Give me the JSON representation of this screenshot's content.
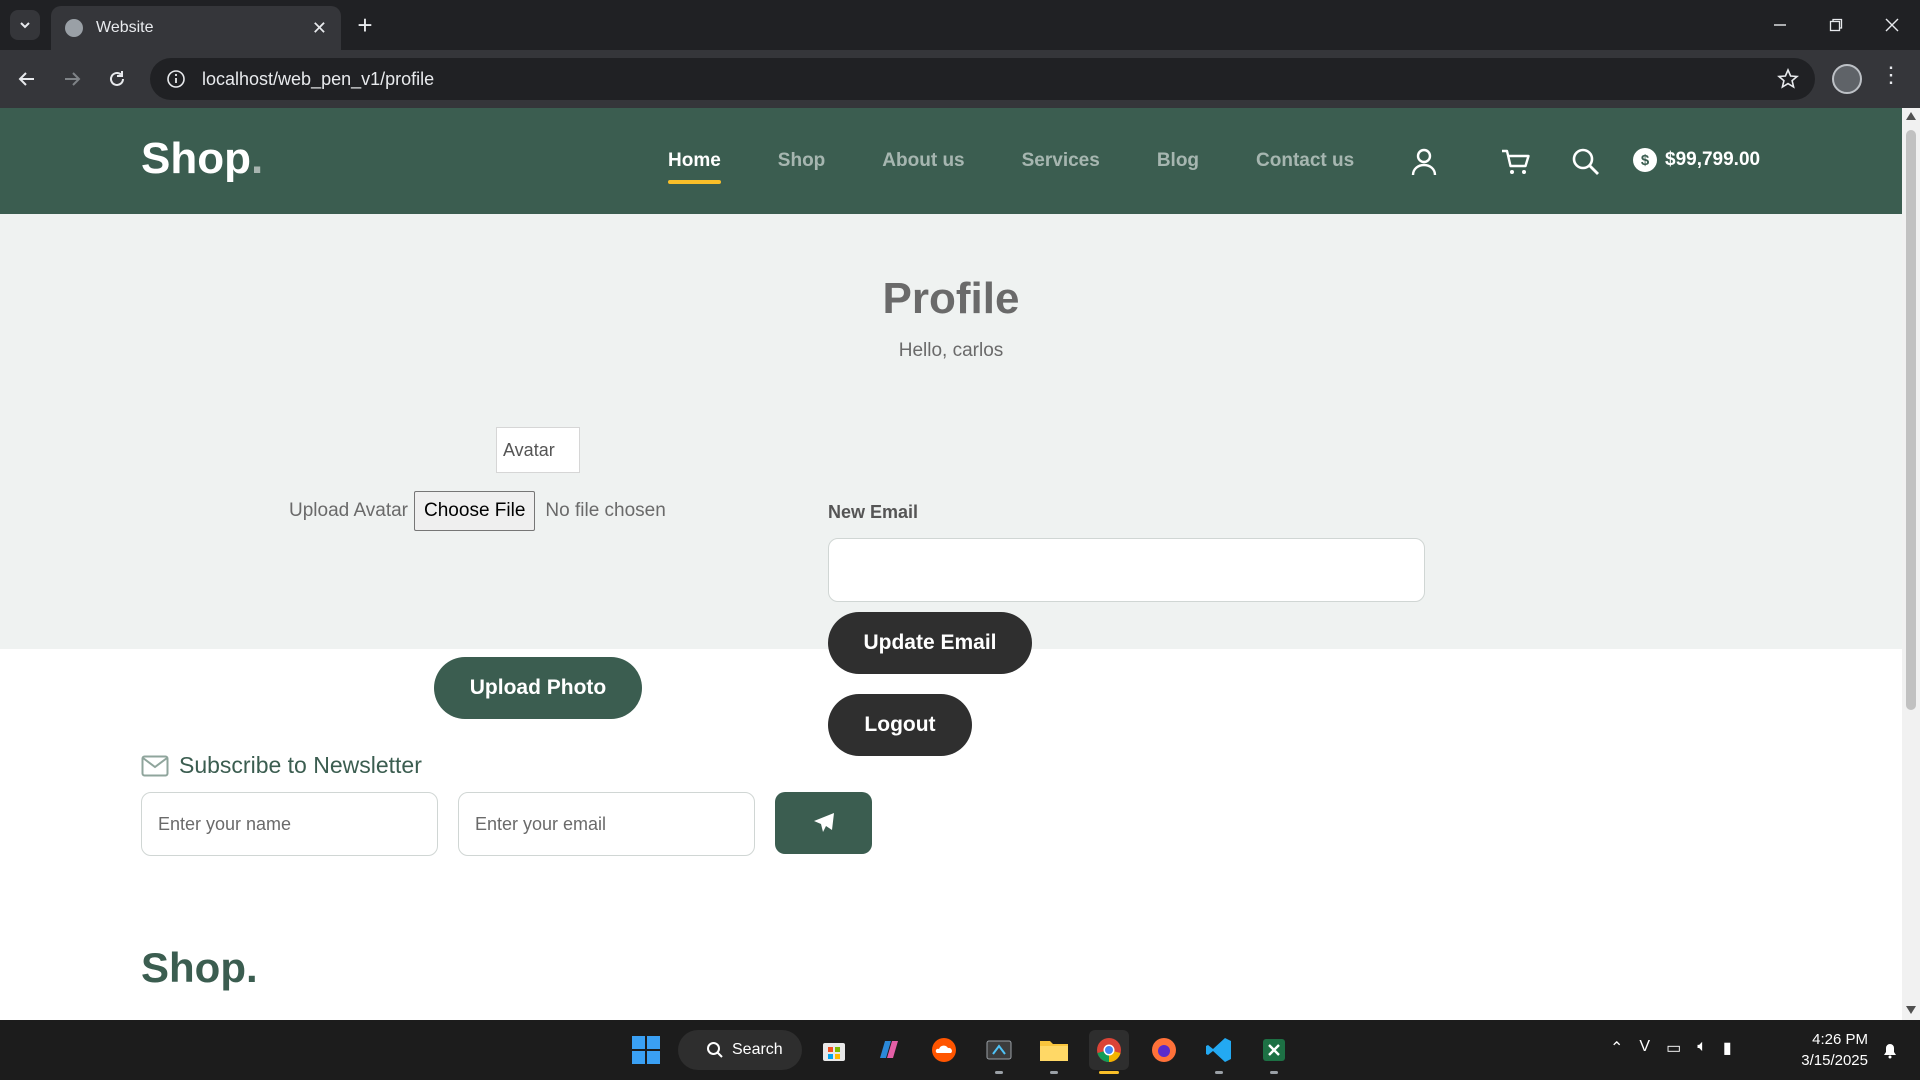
{
  "browser": {
    "tab_title": "Website",
    "url": "localhost/web_pen_v1/profile"
  },
  "site": {
    "logo": "Shop",
    "logo_dot": ".",
    "nav": [
      {
        "label": "Home",
        "active": true
      },
      {
        "label": "Shop",
        "active": false
      },
      {
        "label": "About us",
        "active": false
      },
      {
        "label": "Services",
        "active": false
      },
      {
        "label": "Blog",
        "active": false
      },
      {
        "label": "Contact us",
        "active": false
      }
    ],
    "balance": "$99,799.00",
    "coin_symbol": "$",
    "icons": [
      "user-icon",
      "cart-icon",
      "search-icon"
    ],
    "brand_color": "#3b5d50",
    "accent_color": "#f9bf29"
  },
  "profile": {
    "title": "Profile",
    "greeting": "Hello, carlos",
    "avatar_alt": "Avatar",
    "upload_label": "Upload Avatar",
    "choose_file": "Choose File",
    "no_file": "No file chosen",
    "upload_button": "Upload Photo",
    "email_label": "New Email",
    "email_value": "",
    "update_email_button": "Update Email",
    "logout_button": "Logout"
  },
  "newsletter": {
    "title": "Subscribe to Newsletter",
    "name_placeholder": "Enter your name",
    "email_placeholder": "Enter your email"
  },
  "footer": {
    "logo": "Shop",
    "logo_dot": "."
  },
  "taskbar": {
    "search_label": "Search",
    "time": "4:26 PM",
    "date": "3/15/2025"
  }
}
